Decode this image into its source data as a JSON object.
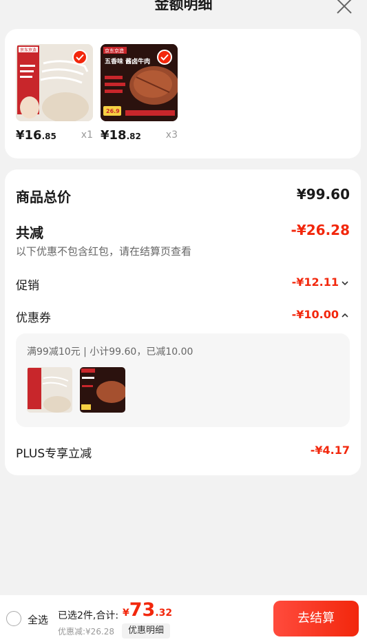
{
  "header": {
    "title": "金额明细",
    "close_icon": "close-icon"
  },
  "products": [
    {
      "thumb_icon": "hangers-product-image",
      "brand": "京东京造",
      "price_int": "¥16",
      "price_dec": ".85",
      "qty": "x1",
      "checked": true
    },
    {
      "thumb_icon": "beef-product-image",
      "brand": "京东京造",
      "headline": "五香味 酱卤牛肉",
      "badge": "26.9",
      "price_int": "¥18",
      "price_dec": ".82",
      "qty": "x3",
      "checked": true
    }
  ],
  "summary": {
    "total_label": "商品总价",
    "total_value": "¥99.60",
    "discount_label": "共减",
    "discount_value": "-¥26.28",
    "note": "以下优惠不包含红包，请在结算页查看",
    "promo_label": "促销",
    "promo_value": "-¥12.11",
    "coupon_label": "优惠券",
    "coupon_value": "-¥10.00",
    "coupon_detail": "满99减10元 | 小计99.60，已减10.00",
    "plus_label": "PLUS专享立减",
    "plus_value": "-¥4.17"
  },
  "bottom": {
    "select_all": "全选",
    "selected": "已选2件,合计:",
    "amount_yen": "¥",
    "amount_int": "73",
    "amount_dec": ".32",
    "saved": "优惠减:¥26.28",
    "detail_tag": "优惠明细",
    "checkout": "去结算"
  },
  "colors": {
    "accent": "#f2270c",
    "background": "#f2f2f2",
    "card": "#ffffff"
  }
}
